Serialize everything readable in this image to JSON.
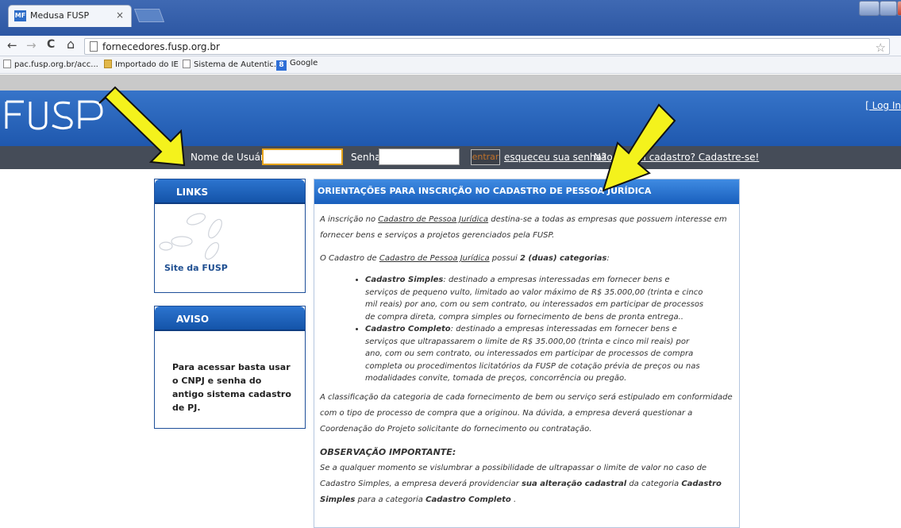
{
  "browser": {
    "tab_title": "Medusa FUSP",
    "tab_favicon": "MF",
    "tab_close": "×",
    "url": "fornecedores.fusp.org.br",
    "nav": {
      "back": "←",
      "forward": "→",
      "reload": "C",
      "home": "⌂",
      "star": "☆"
    },
    "bookmarks": [
      {
        "label": "pac.fusp.org.br/acc...",
        "icon": "page-icon"
      },
      {
        "label": "Importado do IE",
        "icon": "folder-icon"
      },
      {
        "label": "Sistema de Autentic...",
        "icon": "page-icon"
      },
      {
        "label": "Google",
        "icon": "google-icon"
      }
    ]
  },
  "header": {
    "logo_text": "FUSP",
    "login_link": "[ Log In"
  },
  "login": {
    "username_label": "Nome de Usuário",
    "password_label": "Senha",
    "submit": "entrar",
    "forgot": "esqueceu sua senha?",
    "register": "Não possui cadastro? Cadastre-se!"
  },
  "links_box": {
    "title": "LINKS",
    "item": "Site da FUSP"
  },
  "aviso_box": {
    "title": "AVISO",
    "text": "Para acessar basta usar o CNPJ e senha do antigo sistema cadastro de PJ."
  },
  "main": {
    "title": "ORIENTAÇÕES PARA INSCRIÇÃO NO CADASTRO DE PESSOA JURÍDICA",
    "p1_a": "A inscrição no ",
    "p1_link": "Cadastro de Pessoa Jurídica",
    "p1_b": " destina-se a todas as empresas que possuem interesse em fornecer bens e serviços a projetos gerenciados pela FUSP.",
    "p2_a": "O Cadastro de ",
    "p2_link": "Cadastro de Pessoa Jurídica",
    "p2_b": " possui ",
    "p2_bold": "2 (duas) categorias",
    "p2_c": ":",
    "li1_bold": "Cadastro Simples",
    "li1_text": ": destinado a empresas interessadas em fornecer bens e serviços de pequeno vulto, limitado ao valor máximo de R$ 35.000,00 (trinta e cinco mil reais) por ano, com ou sem contrato, ou interessados em participar de processos de compra direta, compra simples ou fornecimento de bens de pronta entrega..",
    "li2_bold": "Cadastro Completo",
    "li2_text": ": destinado a empresas interessadas em fornecer bens e serviços que ultrapassarem o limite de R$ 35.000,00 (trinta e cinco mil reais) por ano, com ou sem contrato, ou interessados em participar de processos de compra completa ou procedimentos licitatórios da FUSP de cotação prévia de preços ou nas modalidades convite, tomada de preços, concorrência ou pregão.",
    "p3": "A classificação da categoria de cada fornecimento de bem ou serviço será estipulado em conformidade com o tipo de processo de compra que a originou. Na dúvida, a empresa deverá questionar a Coordenação do Projeto solicitante do fornecimento ou contratação.",
    "obs_title": "OBSERVAÇÃO IMPORTANTE:",
    "obs_a": "Se a qualquer momento se vislumbrar a possibilidade de ultrapassar o limite de valor no caso de Cadastro Simples, a empresa deverá providenciar ",
    "obs_b1": "sua alteração cadastral",
    "obs_c": " da categoria ",
    "obs_b2": "Cadastro Simples",
    "obs_d": " para a categoria ",
    "obs_b3": "Cadastro Completo",
    "obs_e": " ."
  },
  "colors": {
    "header_blue": "#2a66bf",
    "login_bar": "#454c58",
    "arrow": "#f4f21c"
  }
}
